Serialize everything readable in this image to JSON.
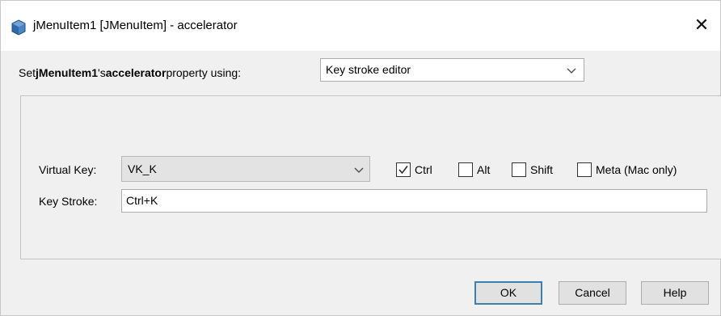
{
  "window": {
    "title": "jMenuItem1 [JMenuItem] - accelerator",
    "close_glyph": "✕"
  },
  "property_row": {
    "prefix": "Set ",
    "component": "jMenuItem1",
    "possessive": "'s ",
    "property": "accelerator",
    "suffix": " property using:",
    "editor_selected": "Key stroke editor"
  },
  "editor": {
    "virtual_key_label": "Virtual Key:",
    "virtual_key_value": "VK_K",
    "modifiers": [
      {
        "label": "Ctrl",
        "checked": true
      },
      {
        "label": "Alt",
        "checked": false
      },
      {
        "label": "Shift",
        "checked": false
      },
      {
        "label": "Meta (Mac only)",
        "checked": false
      }
    ],
    "key_stroke_label": "Key Stroke:",
    "key_stroke_value": "Ctrl+K"
  },
  "buttons": {
    "ok": "OK",
    "cancel": "Cancel",
    "help": "Help"
  },
  "colors": {
    "default_button_border": "#3c7fb1",
    "dialog_background": "#f0f0f0"
  }
}
